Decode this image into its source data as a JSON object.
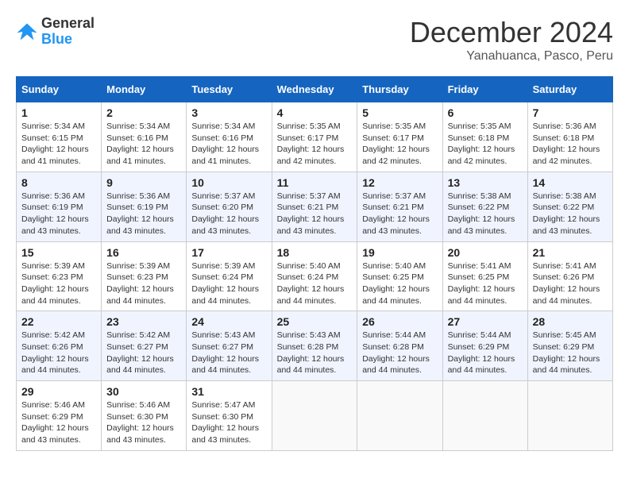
{
  "header": {
    "logo_line1": "General",
    "logo_line2": "Blue",
    "month_title": "December 2024",
    "location": "Yanahuanca, Pasco, Peru"
  },
  "days_of_week": [
    "Sunday",
    "Monday",
    "Tuesday",
    "Wednesday",
    "Thursday",
    "Friday",
    "Saturday"
  ],
  "weeks": [
    [
      {
        "day": 1,
        "sunrise": "5:34 AM",
        "sunset": "6:15 PM",
        "daylight": "12 hours and 41 minutes."
      },
      {
        "day": 2,
        "sunrise": "5:34 AM",
        "sunset": "6:16 PM",
        "daylight": "12 hours and 41 minutes."
      },
      {
        "day": 3,
        "sunrise": "5:34 AM",
        "sunset": "6:16 PM",
        "daylight": "12 hours and 41 minutes."
      },
      {
        "day": 4,
        "sunrise": "5:35 AM",
        "sunset": "6:17 PM",
        "daylight": "12 hours and 42 minutes."
      },
      {
        "day": 5,
        "sunrise": "5:35 AM",
        "sunset": "6:17 PM",
        "daylight": "12 hours and 42 minutes."
      },
      {
        "day": 6,
        "sunrise": "5:35 AM",
        "sunset": "6:18 PM",
        "daylight": "12 hours and 42 minutes."
      },
      {
        "day": 7,
        "sunrise": "5:36 AM",
        "sunset": "6:18 PM",
        "daylight": "12 hours and 42 minutes."
      }
    ],
    [
      {
        "day": 8,
        "sunrise": "5:36 AM",
        "sunset": "6:19 PM",
        "daylight": "12 hours and 43 minutes."
      },
      {
        "day": 9,
        "sunrise": "5:36 AM",
        "sunset": "6:19 PM",
        "daylight": "12 hours and 43 minutes."
      },
      {
        "day": 10,
        "sunrise": "5:37 AM",
        "sunset": "6:20 PM",
        "daylight": "12 hours and 43 minutes."
      },
      {
        "day": 11,
        "sunrise": "5:37 AM",
        "sunset": "6:21 PM",
        "daylight": "12 hours and 43 minutes."
      },
      {
        "day": 12,
        "sunrise": "5:37 AM",
        "sunset": "6:21 PM",
        "daylight": "12 hours and 43 minutes."
      },
      {
        "day": 13,
        "sunrise": "5:38 AM",
        "sunset": "6:22 PM",
        "daylight": "12 hours and 43 minutes."
      },
      {
        "day": 14,
        "sunrise": "5:38 AM",
        "sunset": "6:22 PM",
        "daylight": "12 hours and 43 minutes."
      }
    ],
    [
      {
        "day": 15,
        "sunrise": "5:39 AM",
        "sunset": "6:23 PM",
        "daylight": "12 hours and 44 minutes."
      },
      {
        "day": 16,
        "sunrise": "5:39 AM",
        "sunset": "6:23 PM",
        "daylight": "12 hours and 44 minutes."
      },
      {
        "day": 17,
        "sunrise": "5:39 AM",
        "sunset": "6:24 PM",
        "daylight": "12 hours and 44 minutes."
      },
      {
        "day": 18,
        "sunrise": "5:40 AM",
        "sunset": "6:24 PM",
        "daylight": "12 hours and 44 minutes."
      },
      {
        "day": 19,
        "sunrise": "5:40 AM",
        "sunset": "6:25 PM",
        "daylight": "12 hours and 44 minutes."
      },
      {
        "day": 20,
        "sunrise": "5:41 AM",
        "sunset": "6:25 PM",
        "daylight": "12 hours and 44 minutes."
      },
      {
        "day": 21,
        "sunrise": "5:41 AM",
        "sunset": "6:26 PM",
        "daylight": "12 hours and 44 minutes."
      }
    ],
    [
      {
        "day": 22,
        "sunrise": "5:42 AM",
        "sunset": "6:26 PM",
        "daylight": "12 hours and 44 minutes."
      },
      {
        "day": 23,
        "sunrise": "5:42 AM",
        "sunset": "6:27 PM",
        "daylight": "12 hours and 44 minutes."
      },
      {
        "day": 24,
        "sunrise": "5:43 AM",
        "sunset": "6:27 PM",
        "daylight": "12 hours and 44 minutes."
      },
      {
        "day": 25,
        "sunrise": "5:43 AM",
        "sunset": "6:28 PM",
        "daylight": "12 hours and 44 minutes."
      },
      {
        "day": 26,
        "sunrise": "5:44 AM",
        "sunset": "6:28 PM",
        "daylight": "12 hours and 44 minutes."
      },
      {
        "day": 27,
        "sunrise": "5:44 AM",
        "sunset": "6:29 PM",
        "daylight": "12 hours and 44 minutes."
      },
      {
        "day": 28,
        "sunrise": "5:45 AM",
        "sunset": "6:29 PM",
        "daylight": "12 hours and 44 minutes."
      }
    ],
    [
      {
        "day": 29,
        "sunrise": "5:46 AM",
        "sunset": "6:29 PM",
        "daylight": "12 hours and 43 minutes."
      },
      {
        "day": 30,
        "sunrise": "5:46 AM",
        "sunset": "6:30 PM",
        "daylight": "12 hours and 43 minutes."
      },
      {
        "day": 31,
        "sunrise": "5:47 AM",
        "sunset": "6:30 PM",
        "daylight": "12 hours and 43 minutes."
      },
      null,
      null,
      null,
      null
    ]
  ],
  "labels": {
    "sunrise": "Sunrise:",
    "sunset": "Sunset:",
    "daylight": "Daylight:"
  }
}
